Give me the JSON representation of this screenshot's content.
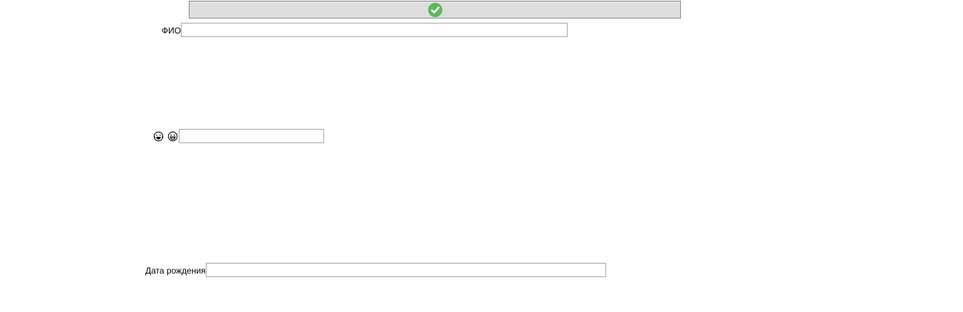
{
  "form": {
    "confirm_button": {
      "icon": "check-circle-icon",
      "accent": "#5cb85c"
    },
    "full_name": {
      "label": "ФИО",
      "value": "",
      "placeholder": ""
    },
    "emoji_field": {
      "icons": [
        "laughing-tears-emoji-icon",
        "grinning-emoji-icon"
      ],
      "value": "",
      "placeholder": ""
    },
    "birth_date": {
      "label": "Дата рождения",
      "value": "",
      "placeholder": ""
    }
  }
}
